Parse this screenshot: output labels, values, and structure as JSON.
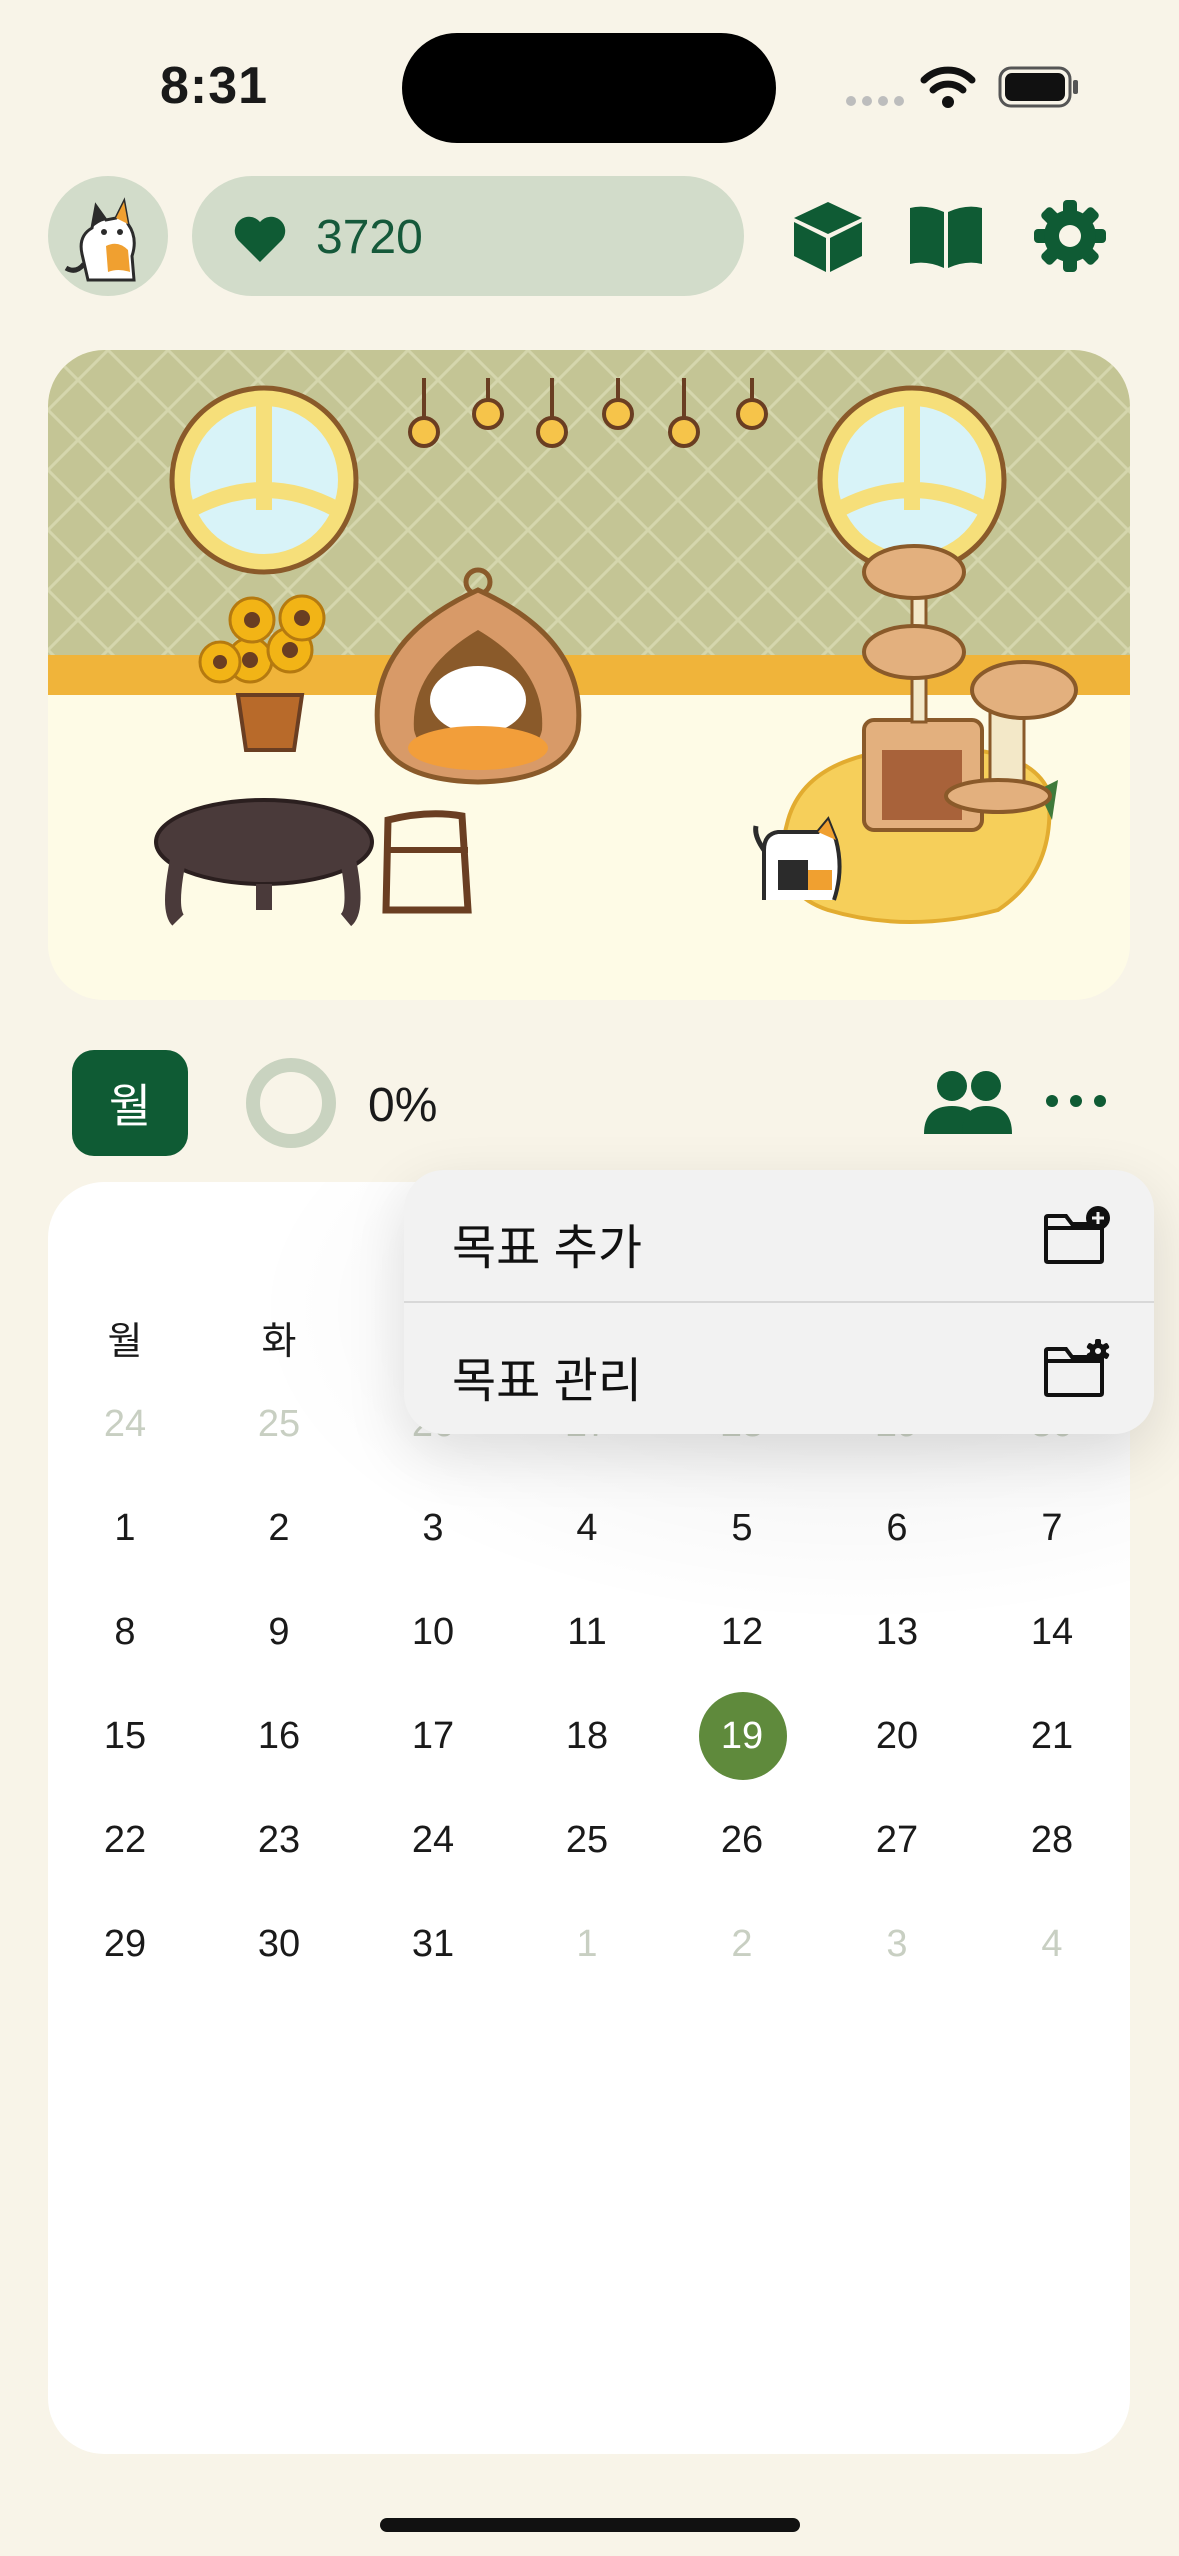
{
  "status_bar": {
    "time": "8:31"
  },
  "header": {
    "hearts": "3720"
  },
  "controls": {
    "view_mode_label": "월",
    "progress_text": "0%"
  },
  "menu": {
    "items": [
      {
        "label": "목표 추가",
        "icon": "folder-add-icon"
      },
      {
        "label": "목표 관리",
        "icon": "folder-settings-icon"
      }
    ]
  },
  "calendar": {
    "weekdays": [
      "월",
      "화"
    ],
    "weeks": [
      [
        {
          "d": "24",
          "dim": true
        },
        {
          "d": "25",
          "dim": true
        },
        {
          "d": "26",
          "dim": true
        },
        {
          "d": "27",
          "dim": true
        },
        {
          "d": "28",
          "dim": true
        },
        {
          "d": "29",
          "dim": true
        },
        {
          "d": "30",
          "dim": true
        }
      ],
      [
        {
          "d": "1"
        },
        {
          "d": "2"
        },
        {
          "d": "3"
        },
        {
          "d": "4"
        },
        {
          "d": "5"
        },
        {
          "d": "6"
        },
        {
          "d": "7"
        }
      ],
      [
        {
          "d": "8"
        },
        {
          "d": "9"
        },
        {
          "d": "10"
        },
        {
          "d": "11"
        },
        {
          "d": "12"
        },
        {
          "d": "13"
        },
        {
          "d": "14"
        }
      ],
      [
        {
          "d": "15"
        },
        {
          "d": "16"
        },
        {
          "d": "17"
        },
        {
          "d": "18"
        },
        {
          "d": "19",
          "today": true
        },
        {
          "d": "20"
        },
        {
          "d": "21"
        }
      ],
      [
        {
          "d": "22"
        },
        {
          "d": "23"
        },
        {
          "d": "24"
        },
        {
          "d": "25"
        },
        {
          "d": "26"
        },
        {
          "d": "27"
        },
        {
          "d": "28"
        }
      ],
      [
        {
          "d": "29"
        },
        {
          "d": "30"
        },
        {
          "d": "31"
        },
        {
          "d": "1",
          "dim": true
        },
        {
          "d": "2",
          "dim": true
        },
        {
          "d": "3",
          "dim": true
        },
        {
          "d": "4",
          "dim": true
        }
      ]
    ]
  },
  "colors": {
    "accent": "#0f5b34",
    "today": "#5f8a3c",
    "pill": "#d2dcca"
  }
}
